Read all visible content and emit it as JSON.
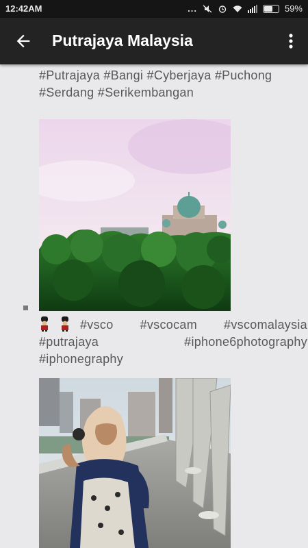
{
  "status": {
    "time": "12:42AM",
    "battery": "59%",
    "dots": "..."
  },
  "appbar": {
    "title": "Putrajaya Malaysia"
  },
  "posts": [
    {
      "caption": "#Putrajaya #Bangi #Cyberjaya #Puchong #Serdang #Serikembangan"
    },
    {
      "caption": "#vsco #vscocam #vscomalaysia #putrajaya #iphone6photography #iphonegraphy",
      "emoji": "💂 💂"
    }
  ],
  "icons": [
    "back-arrow-icon",
    "more-vert-icon",
    "alarm-icon",
    "wifi-icon",
    "signal-icon",
    "battery-icon",
    "guard-emoji-icon"
  ]
}
